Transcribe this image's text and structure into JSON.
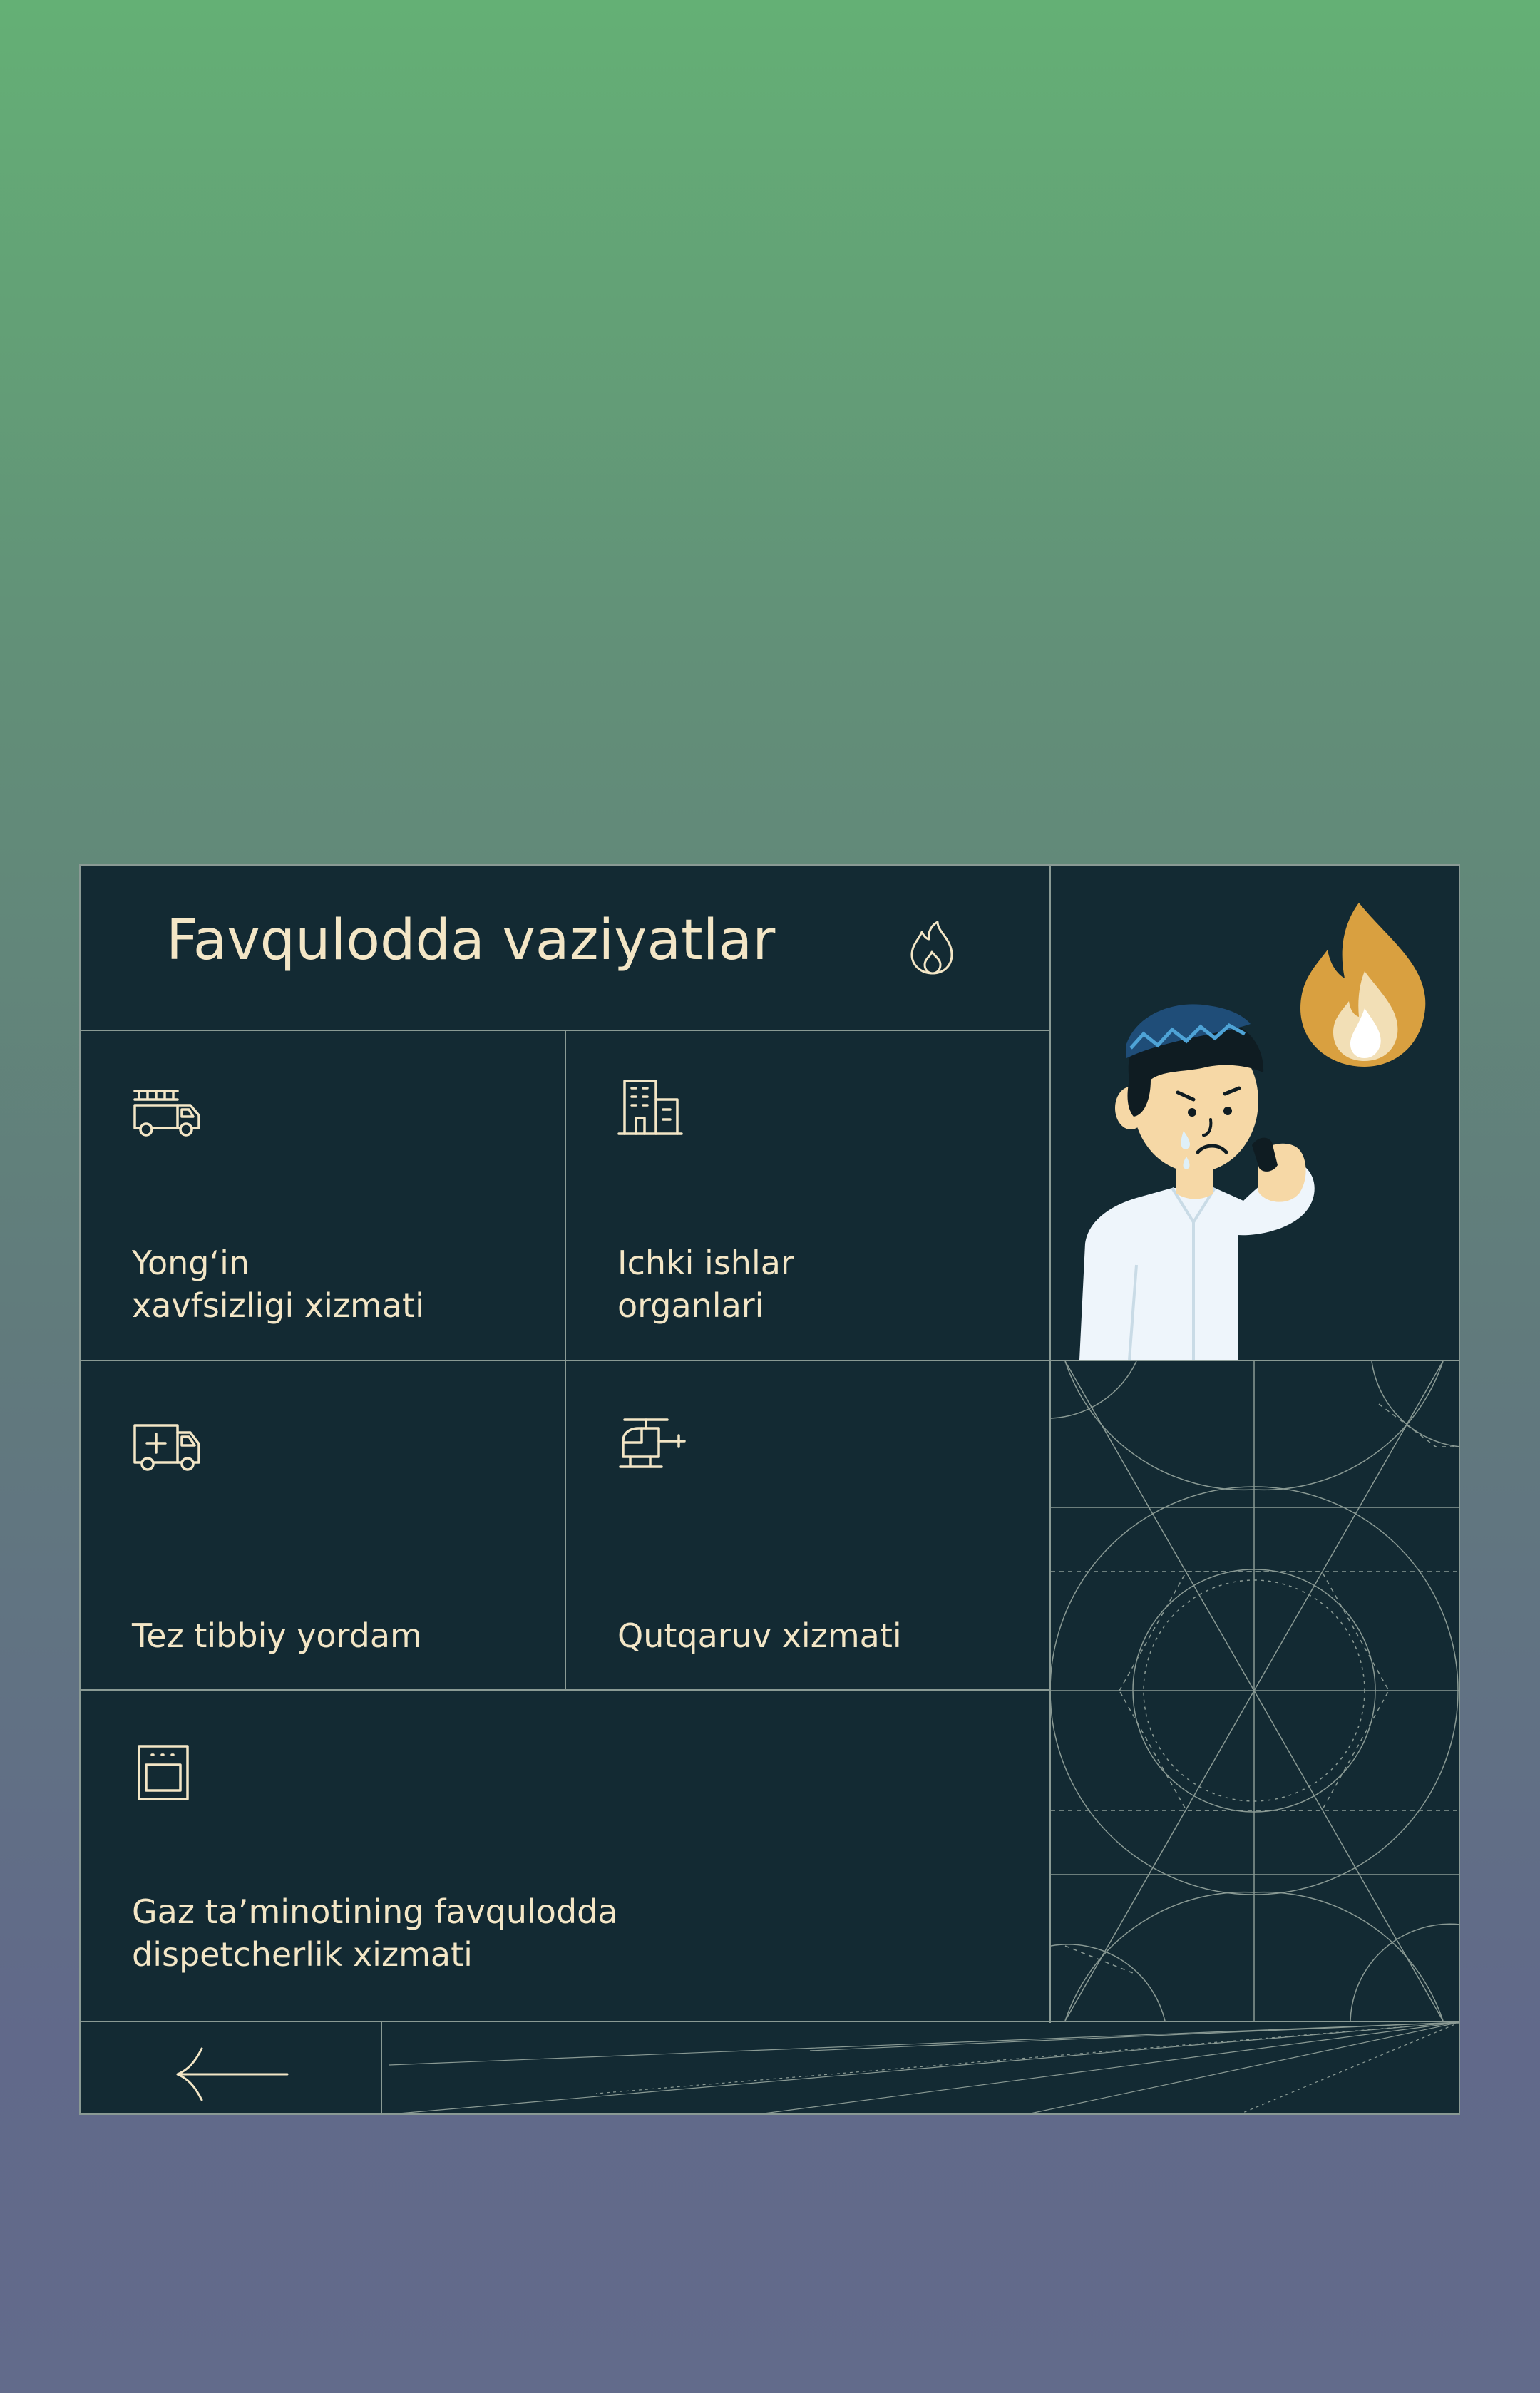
{
  "header": {
    "title": "Favqulodda vaziyatlar",
    "title_icon": "fire-icon"
  },
  "services": [
    {
      "label": "Yong‘in\nxavfsizligi xizmati",
      "icon": "fire-truck-icon"
    },
    {
      "label": "Ichki ishlar\norganlari",
      "icon": "building-icon"
    },
    {
      "label": "Tez tibbiy yordam",
      "icon": "ambulance-icon"
    },
    {
      "label": "Qutqaruv xizmati",
      "icon": "helicopter-icon"
    },
    {
      "label": "Gaz ta’minotining favqulodda\ndispetcherlik xizmati",
      "icon": "gas-stove-icon"
    }
  ],
  "footer": {
    "back_icon": "arrow-left-icon"
  },
  "colors": {
    "panel_bg": "#132a33",
    "text": "#f3e6c6",
    "grid_line": "#8a9a94",
    "flame": "#d9a040"
  }
}
